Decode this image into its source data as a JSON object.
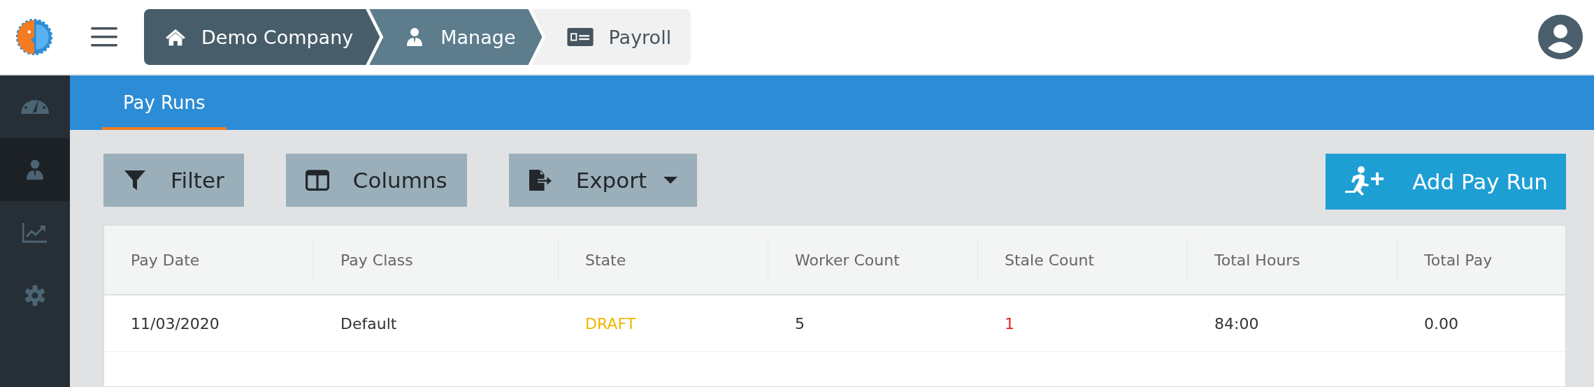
{
  "breadcrumb": [
    {
      "label": "Demo Company",
      "kind": "home"
    },
    {
      "label": "Manage",
      "kind": "person"
    },
    {
      "label": "Payroll",
      "kind": "card"
    }
  ],
  "sidebar": {
    "items": [
      {
        "kind": "dashboard",
        "selected": false
      },
      {
        "kind": "person",
        "selected": true
      },
      {
        "kind": "chart",
        "selected": false
      },
      {
        "kind": "settings",
        "selected": false
      }
    ]
  },
  "tabs": [
    {
      "label": "Pay Runs",
      "selected": true
    }
  ],
  "toolbar": {
    "buttons": [
      {
        "label": "Filter",
        "kind": "filter"
      },
      {
        "label": "Columns",
        "kind": "columns"
      },
      {
        "label": "Export",
        "kind": "export"
      }
    ],
    "primary_button": {
      "label": "Add Pay Run"
    }
  },
  "table": {
    "columns": [
      "Pay Date",
      "Pay Class",
      "State",
      "Worker Count",
      "Stale Count",
      "Total Hours",
      "Total Pay"
    ],
    "rows": [
      {
        "cells": [
          {
            "text": "11/03/2020"
          },
          {
            "text": "Default"
          },
          {
            "text": "DRAFT",
            "color": "#f0b400"
          },
          {
            "text": "5"
          },
          {
            "text": "1",
            "color": "#e3231c"
          },
          {
            "text": "84:00"
          },
          {
            "text": "0.00"
          }
        ]
      }
    ]
  }
}
